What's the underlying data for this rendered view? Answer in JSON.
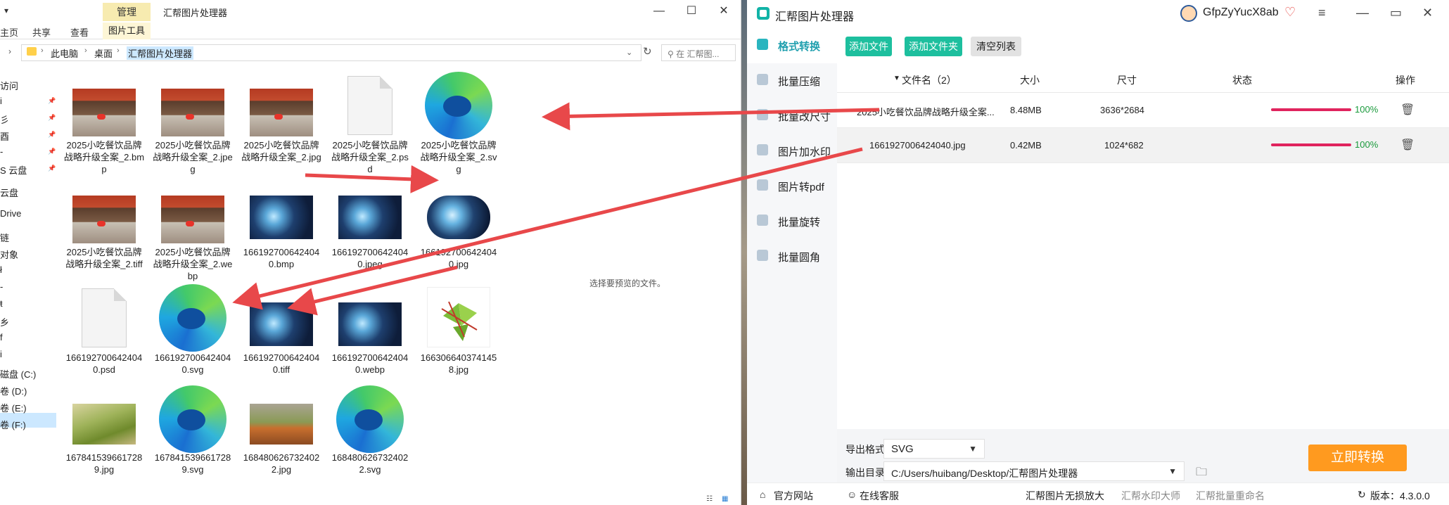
{
  "explorer": {
    "qat": "▾",
    "context_tab": "管理",
    "window_title": "汇帮图片处理器",
    "ribbon_tabs": [
      "主页",
      "共享",
      "查看"
    ],
    "context_ribbon_tab": "图片工具",
    "breadcrumb": [
      "此电脑",
      "桌面",
      "汇帮图片处理器"
    ],
    "search_placeholder": "在 汇帮图...",
    "nav_items": [
      "访问",
      "",
      "",
      "",
      "",
      "S 云盘",
      "云盘",
      "Drive",
      "",
      "链",
      "对象",
      "",
      "",
      "",
      "",
      "",
      "磁盘 (C:)",
      "卷 (D:)",
      "卷 (E:)",
      "卷 (F:)"
    ],
    "files": [
      {
        "name": "2025小吃餐饮品牌战略升级全案_2.bmp",
        "thumb": "shop-photo"
      },
      {
        "name": "2025小吃餐饮品牌战略升级全案_2.jpeg",
        "thumb": "shop-photo"
      },
      {
        "name": "2025小吃餐饮品牌战略升级全案_2.jpg",
        "thumb": "shop-photo"
      },
      {
        "name": "2025小吃餐饮品牌战略升级全案_2.psd",
        "thumb": "generic-file-icon"
      },
      {
        "name": "2025小吃餐饮品牌战略升级全案_2.svg",
        "thumb": "edge-icon"
      },
      {
        "name": "2025小吃餐饮品牌战略升级全案_2.tiff",
        "thumb": "shop-photo"
      },
      {
        "name": "2025小吃餐饮品牌战略升级全案_2.webp",
        "thumb": "shop-photo"
      },
      {
        "name": "1661927006424040.bmp",
        "thumb": "tech-photo"
      },
      {
        "name": "1661927006424040.jpeg",
        "thumb": "tech-photo"
      },
      {
        "name": "1661927006424040.jpg",
        "thumb": "tech-photo-rounded"
      },
      {
        "name": "1661927006424040.psd",
        "thumb": "generic-file-icon"
      },
      {
        "name": "1661927006424040.svg",
        "thumb": "edge-icon"
      },
      {
        "name": "1661927006424040.tiff",
        "thumb": "tech-photo"
      },
      {
        "name": "1661927006424040.webp",
        "thumb": "tech-photo"
      },
      {
        "name": "1663066403741458.jpg",
        "thumb": "zongzi-photo"
      },
      {
        "name": "1678415396617289.jpg",
        "thumb": "vegetable-photo"
      },
      {
        "name": "1678415396617289.svg",
        "thumb": "edge-icon"
      },
      {
        "name": "1684806267324022.jpg",
        "thumb": "cake-photo"
      },
      {
        "name": "1684806267324022.svg",
        "thumb": "edge-icon"
      }
    ],
    "preview_text": "选择要预览的文件。"
  },
  "app": {
    "title": "汇帮图片处理器",
    "username": "GfpZyYucX8ab",
    "sidebar": [
      "格式转换",
      "批量压缩",
      "批量改尺寸",
      "图片加水印",
      "图片转pdf",
      "批量旋转",
      "批量圆角"
    ],
    "toolbar": {
      "add_file": "添加文件",
      "add_folder": "添加文件夹",
      "clear": "清空列表"
    },
    "columns": {
      "name": "文件名（2）",
      "size": "大小",
      "dimension": "尺寸",
      "status": "状态",
      "action": "操作"
    },
    "rows": [
      {
        "name": "2025小吃餐饮品牌战略升级全案...",
        "size": "8.48MB",
        "dimension": "3636*2684",
        "progress": "100%"
      },
      {
        "name": "1661927006424040.jpg",
        "size": "0.42MB",
        "dimension": "1024*682",
        "progress": "100%"
      }
    ],
    "export": {
      "format_label": "导出格式:",
      "format_value": "SVG",
      "dir_label": "输出目录:",
      "dir_value": "C:/Users/huibang/Desktop/汇帮图片处理器",
      "convert_button": "立即转换"
    },
    "footer": {
      "website": "官方网站",
      "support": "在线客服",
      "link1": "汇帮图片无损放大",
      "link2": "汇帮水印大师",
      "link3": "汇帮批量重命名",
      "version": "版本：4.3.0.0"
    },
    "colors": {
      "accent": "#1f9fae",
      "green_button": "#1dbf9e",
      "convert_orange": "#ff9a1f",
      "progress_bar": "#e0245e",
      "annotation_arrow": "#e8484a"
    }
  }
}
